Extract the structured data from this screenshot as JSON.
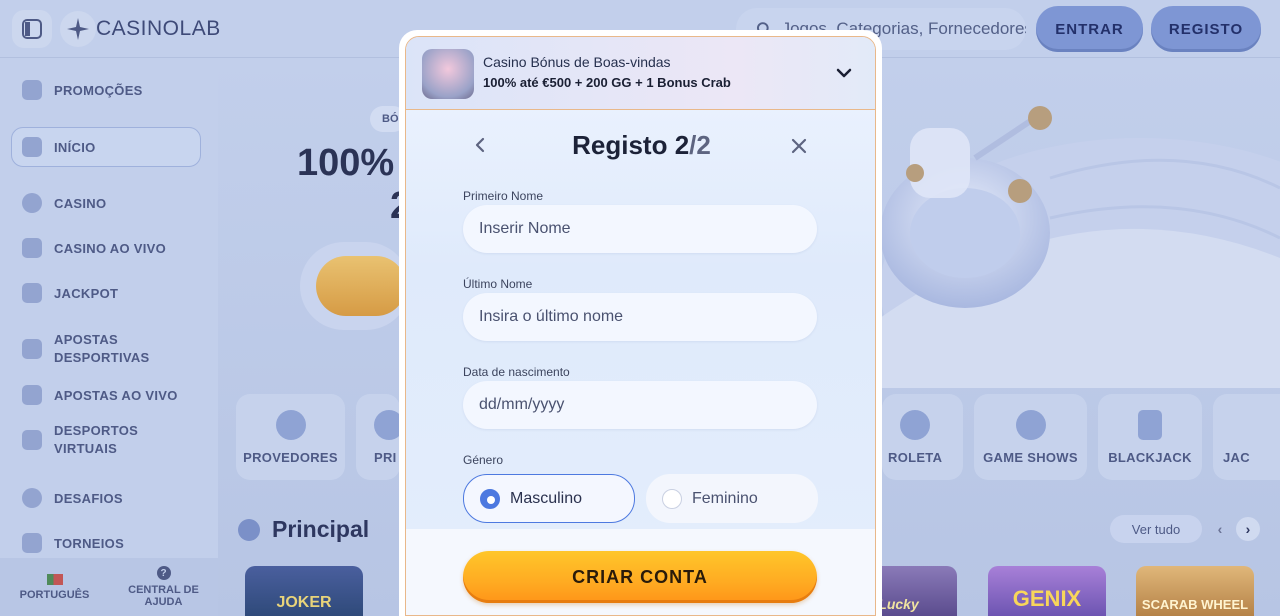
{
  "header": {
    "logo_text": "CASINOLAB",
    "search_placeholder": "Jogos, Categorias, Fornecedores",
    "login_label": "ENTRAR",
    "register_label": "REGISTO"
  },
  "sidebar": {
    "items": [
      {
        "label": "PROMOÇÕES",
        "icon": "megaphone-icon"
      },
      {
        "label": "INÍCIO",
        "icon": "home-icon"
      },
      {
        "label": "CASINO",
        "icon": "chip-icon"
      },
      {
        "label": "CASINO AO VIVO",
        "icon": "live-icon"
      },
      {
        "label": "JACKPOT",
        "icon": "jackpot-icon"
      },
      {
        "label": "APOSTAS DESPORTIVAS",
        "icon": "ticket-icon"
      },
      {
        "label": "APOSTAS AO VIVO",
        "icon": "live-bet-icon"
      },
      {
        "label": "DESPORTOS VIRTUAIS",
        "icon": "virtual-sport-icon"
      },
      {
        "label": "DESAFIOS",
        "icon": "gear-icon"
      },
      {
        "label": "TORNEIOS",
        "icon": "trophy-icon"
      }
    ],
    "active_item": "INÍCIO",
    "footer": {
      "language": "PORTUGUÊS",
      "help": "CENTRAL DE AJUDA"
    }
  },
  "hero": {
    "badge": "BÓ",
    "headline": "100%",
    "subline": "2"
  },
  "categories": [
    "PROVEDORES",
    "PRI",
    "ROLETA",
    "GAME SHOWS",
    "BLACKJACK",
    "JAC"
  ],
  "principal": {
    "title": "Principal",
    "see_all": "Ver tudo"
  },
  "games": [
    "JOKER",
    "Lucky",
    "GENIX",
    "SCARAB WHEEL"
  ],
  "modal": {
    "bonus": {
      "title": "Casino Bónus de Boas-vindas",
      "offer": "100% até €500 + 200 GG + 1 Bonus Crab"
    },
    "title_main": "Registo 2",
    "title_sep": "/",
    "title_total": "2",
    "fields": {
      "first_name_label": "Primeiro Nome",
      "first_name_placeholder": "Inserir Nome",
      "last_name_label": "Último Nome",
      "last_name_placeholder": "Insira o último nome",
      "dob_label": "Data de nascimento",
      "dob_placeholder": "dd/mm/yyyy",
      "gender_label": "Género",
      "gender_options": [
        "Masculino",
        "Feminino"
      ],
      "gender_selected": "Masculino"
    },
    "submit_label": "CRIAR CONTA"
  },
  "colors": {
    "accent": "#4d79e0",
    "cta": "#ffab22",
    "overlay": "#b9c8e6"
  }
}
